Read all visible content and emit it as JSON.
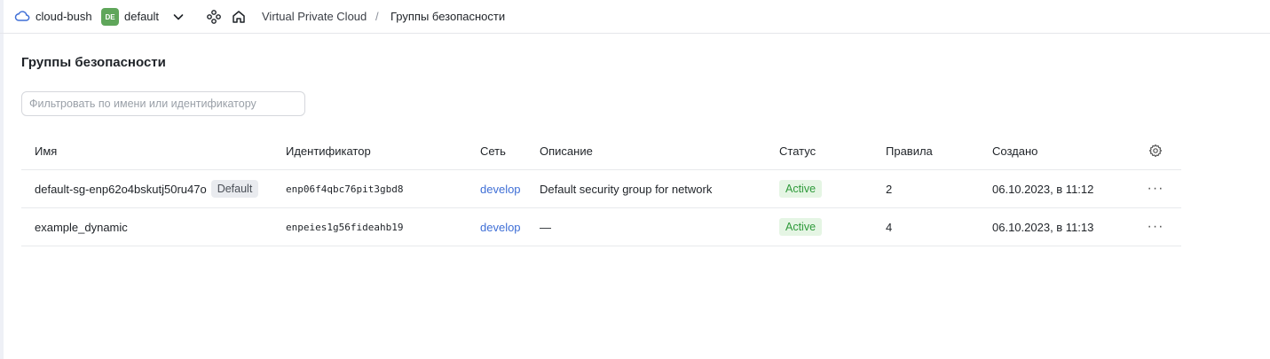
{
  "topbar": {
    "cloud_label": "cloud-bush",
    "folder_badge": "DE",
    "folder_label": "default",
    "breadcrumb": [
      "Virtual Private Cloud",
      "Группы безопасности"
    ],
    "separator": "/"
  },
  "page": {
    "title": "Группы безопасности",
    "filter_placeholder": "Фильтровать по имени или идентификатору",
    "filter_value": ""
  },
  "table": {
    "columns": [
      "Имя",
      "Идентификатор",
      "Сеть",
      "Описание",
      "Статус",
      "Правила",
      "Создано"
    ],
    "rows": [
      {
        "name": "default-sg-enp62o4bskutj50ru47o",
        "tag": "Default",
        "id": "enp06f4qbc76pit3gbd8",
        "network": "develop",
        "description": "Default security group for network",
        "status": "Active",
        "rules": "2",
        "created": "06.10.2023, в 11:12"
      },
      {
        "name": "example_dynamic",
        "tag": "",
        "id": "enpeies1g56fideahb19",
        "network": "develop",
        "description": "—",
        "status": "Active",
        "rules": "4",
        "created": "06.10.2023, в 11:13"
      }
    ],
    "row_actions_label": "···"
  },
  "icons": {
    "cloud": "cloud-icon",
    "chevron": "chevron-down-icon",
    "services": "services-icon",
    "home": "home-icon",
    "settings": "gear-icon",
    "more": "more-icon"
  },
  "colors": {
    "folder_badge": "#5fa65a",
    "link": "#3f6fd6",
    "status_active_bg": "#e5f5e4",
    "status_active_text": "#2e9a3a"
  }
}
